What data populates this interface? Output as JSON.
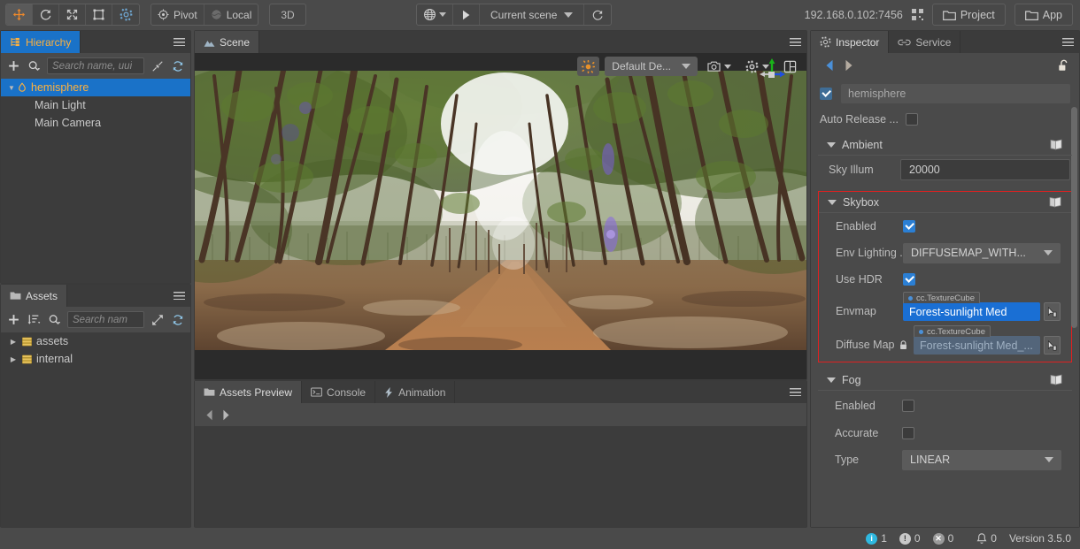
{
  "toolbar": {
    "transform_tools": [
      {
        "name": "move-tool",
        "icon": "move-icon",
        "active": true
      },
      {
        "name": "rotate-tool",
        "icon": "rotate-icon",
        "active": false
      },
      {
        "name": "scale-tool",
        "icon": "scale-icon",
        "active": false
      },
      {
        "name": "rect-tool",
        "icon": "rect-transform-icon",
        "active": false
      },
      {
        "name": "gear-tool",
        "icon": "gear-icon",
        "active": false
      }
    ],
    "pivot_label": "Pivot",
    "coord_label": "Local",
    "dimension_label": "3D",
    "preview_browser_icon": "globe-icon",
    "play_label": "play-icon",
    "scene_select_label": "Current scene",
    "refresh_icon": "refresh-icon",
    "device_address": "192.168.0.102:7456",
    "qr_icon": "qr-code-icon",
    "project_label": "Project",
    "app_label": "App"
  },
  "hierarchy": {
    "tab_label": "Hierarchy",
    "tab_icon": "hierarchy-icon",
    "add_icon": "plus-icon",
    "search_icon": "search-icon",
    "search_placeholder": "Search name, uui",
    "collapse_icon": "collapse-all-icon",
    "refresh_icon": "refresh-icon",
    "menu_icon": "hamburger-icon",
    "nodes": [
      {
        "label": "hemisphere",
        "depth": 0,
        "selected": true,
        "has_caret": true,
        "icon": "scene-node-icon"
      },
      {
        "label": "Main Light",
        "depth": 1,
        "selected": false,
        "has_caret": false,
        "icon": ""
      },
      {
        "label": "Main Camera",
        "depth": 1,
        "selected": false,
        "has_caret": false,
        "icon": ""
      }
    ]
  },
  "assets": {
    "tab_label": "Assets",
    "tab_icon": "folder-icon",
    "add_icon": "plus-icon",
    "sort_icon": "sort-icon",
    "search_icon": "search-icon",
    "search_placeholder": "Search nam",
    "expand_icon": "expand-icon",
    "refresh_icon": "refresh-icon",
    "menu_icon": "hamburger-icon",
    "items": [
      {
        "label": "assets",
        "icon": "db-folder-icon"
      },
      {
        "label": "internal",
        "icon": "db-folder-icon"
      }
    ]
  },
  "scene": {
    "tab_label": "Scene",
    "tab_icon": "scene-icon",
    "menu_icon": "hamburger-icon",
    "gizmo_icon": "axis-gizmo",
    "overlay": {
      "lighting_icon": "sun-icon",
      "device_preset": "Default De...",
      "camera_icon": "camera-icon",
      "gear_icon": "gear-icon",
      "layout_icon": "grid-layout-icon"
    }
  },
  "bottom_dock": {
    "tabs": [
      {
        "label": "Assets Preview",
        "icon": "folder-icon",
        "active": true
      },
      {
        "label": "Console",
        "icon": "console-icon",
        "active": false
      },
      {
        "label": "Animation",
        "icon": "animation-icon",
        "active": false
      }
    ],
    "menu_icon": "hamburger-icon",
    "prev_icon": "arrow-left-icon",
    "next_icon": "arrow-right-icon"
  },
  "inspector": {
    "tabs": [
      {
        "label": "Inspector",
        "icon": "gear-icon",
        "active": true
      },
      {
        "label": "Service",
        "icon": "link-icon",
        "active": false
      }
    ],
    "menu_icon": "hamburger-icon",
    "back_icon": "arrow-left-icon",
    "forward_icon": "arrow-right-icon",
    "lock_icon": "unlock-icon",
    "node_enabled": true,
    "node_name": "hemisphere",
    "auto_release_label": "Auto Release ...",
    "auto_release_checked": false,
    "sections": [
      {
        "id": "ambient",
        "title": "Ambient",
        "help_icon": "book-icon",
        "highlighted": false,
        "rows": [
          {
            "label": "Sky Illum",
            "type": "input",
            "value": "20000"
          }
        ]
      },
      {
        "id": "skybox",
        "title": "Skybox",
        "help_icon": "book-icon",
        "highlighted": true,
        "highlight_color": "#e02020",
        "rows": [
          {
            "label": "Enabled",
            "type": "checkbox",
            "checked": true
          },
          {
            "label": "Env Lighting ...",
            "type": "dropdown",
            "value": "DIFFUSEMAP_WITH..."
          },
          {
            "label": "Use HDR",
            "type": "checkbox",
            "checked": true
          },
          {
            "label": "Envmap",
            "type": "asset",
            "asset_type": "cc.TextureCube",
            "value": "Forest-sunlight Med",
            "locked": false,
            "dim": false,
            "pick_icon": "asset-pick-icon"
          },
          {
            "label": "Diffuse Map",
            "type": "asset",
            "asset_type": "cc.TextureCube",
            "value": "Forest-sunlight Med_...",
            "locked": true,
            "lock_icon": "lock-icon",
            "dim": true,
            "pick_icon": "asset-pick-icon"
          }
        ]
      },
      {
        "id": "fog",
        "title": "Fog",
        "help_icon": "book-icon",
        "highlighted": false,
        "rows": [
          {
            "label": "Enabled",
            "type": "checkbox",
            "checked": false
          },
          {
            "label": "Accurate",
            "type": "checkbox",
            "checked": false
          },
          {
            "label": "Type",
            "type": "dropdown",
            "value": "LINEAR"
          }
        ]
      }
    ]
  },
  "statusbar": {
    "info_count": "1",
    "warn_count": "0",
    "error_count": "0",
    "bell_count": "0",
    "bell_icon": "bell-icon",
    "version": "Version 3.5.0"
  },
  "colors": {
    "accent_blue": "#1a72c8",
    "accent_orange": "#ffb13d",
    "highlight_red": "#e02020",
    "panel_bg": "#4a4a4a",
    "content_bg": "#3c3c3c"
  }
}
